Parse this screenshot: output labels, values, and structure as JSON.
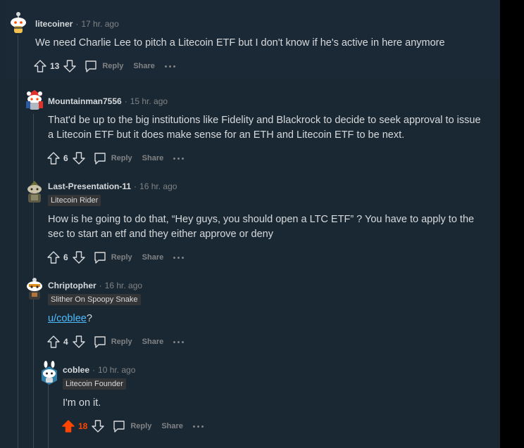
{
  "comments": [
    {
      "username": "litecoiner",
      "time": "17 hr. ago",
      "flair": "",
      "body": "We need Charlie Lee to pitch a Litecoin ETF but I don't know if he's active in here anymore",
      "votes": "13",
      "upvoted": false,
      "reply": "Reply",
      "share": "Share"
    },
    {
      "username": "Mountainman7556",
      "time": "15 hr. ago",
      "flair": "",
      "body": "That'd be up to the big institutions like Fidelity and Blackrock to decide to seek approval to issue a Litecoin ETF but it does make sense for an ETH and Litecoin ETF to be next.",
      "votes": "6",
      "upvoted": false,
      "reply": "Reply",
      "share": "Share"
    },
    {
      "username": "Last-Presentation-11",
      "time": "16 hr. ago",
      "flair": "Litecoin Rider",
      "body": "How is he going to do that, “Hey guys, you should open a LTC ETF” ? You have to apply to the sec to start an etf and they either approve or deny",
      "votes": "6",
      "upvoted": false,
      "reply": "Reply",
      "share": "Share"
    },
    {
      "username": "Chriptopher",
      "time": "16 hr. ago",
      "flair": "Slither On Spoopy Snake",
      "body_link": "u/coblee",
      "body_suffix": "?",
      "votes": "4",
      "upvoted": false,
      "reply": "Reply",
      "share": "Share"
    },
    {
      "username": "coblee",
      "time": "10 hr. ago",
      "flair": "Litecoin Founder",
      "body": "I'm on it.",
      "votes": "18",
      "upvoted": true,
      "reply": "Reply",
      "share": "Share"
    }
  ],
  "separator": "·",
  "colors": {
    "card_bg": "#1a2833",
    "text": "#d7dadc",
    "muted": "#818384",
    "upvote": "#ff4500",
    "link": "#4fbcff"
  },
  "icons": [
    "upvote-icon",
    "downvote-icon",
    "comment-icon",
    "more-icon"
  ]
}
